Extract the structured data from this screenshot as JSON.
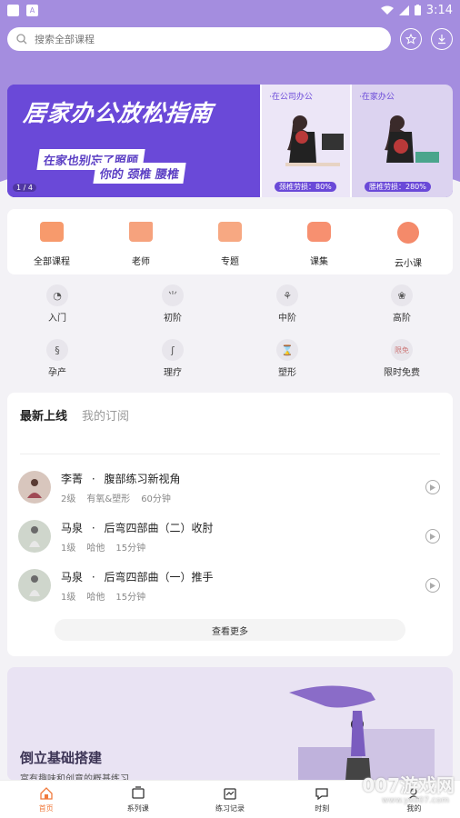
{
  "status_bar": {
    "time": "3:14"
  },
  "search": {
    "placeholder": "搜索全部课程"
  },
  "banner": {
    "title": "居家办公放松指南",
    "tag1": "在家也别忘了照顾",
    "tag2_prefix": "你的",
    "tag2_a": "颈椎",
    "tag2_b": "腰椎",
    "page": "1 / 4",
    "panel1_label": "·在公司办公",
    "panel1_pct": "颈椎劳损：80%",
    "panel2_label": "·在家办公",
    "panel2_pct": "腰椎劳损：280%"
  },
  "categories": [
    {
      "label": "全部课程",
      "icon": "all-courses-icon"
    },
    {
      "label": "老师",
      "icon": "teacher-icon"
    },
    {
      "label": "专题",
      "icon": "topic-icon"
    },
    {
      "label": "课集",
      "icon": "collection-icon"
    },
    {
      "label": "云小课",
      "icon": "cloud-class-icon"
    }
  ],
  "levels": [
    {
      "label": "入门",
      "icon": "beginner-icon"
    },
    {
      "label": "初阶",
      "icon": "elementary-icon"
    },
    {
      "label": "中阶",
      "icon": "intermediate-icon"
    },
    {
      "label": "高阶",
      "icon": "advanced-icon"
    },
    {
      "label": "孕产",
      "icon": "pregnancy-icon"
    },
    {
      "label": "理疗",
      "icon": "therapy-icon"
    },
    {
      "label": "塑形",
      "icon": "shaping-icon"
    },
    {
      "label": "限时免费",
      "icon": "free-icon",
      "badge": "限免"
    }
  ],
  "tabs": [
    {
      "label": "最新上线"
    },
    {
      "label": "我的订阅"
    }
  ],
  "courses": [
    {
      "teacher": "李菁",
      "sep": "·",
      "title": "腹部练习新视角",
      "level": "2级",
      "type": "有氧&塑形",
      "duration": "60分钟"
    },
    {
      "teacher": "马泉",
      "sep": "·",
      "title": "后弯四部曲（二）收肘",
      "level": "1级",
      "type": "哈他",
      "duration": "15分钟"
    },
    {
      "teacher": "马泉",
      "sep": "·",
      "title": "后弯四部曲（一）推手",
      "level": "1级",
      "type": "哈他",
      "duration": "15分钟"
    }
  ],
  "more_label": "查看更多",
  "promo": {
    "title": "倒立基础搭建",
    "subtitle": "富有趣味和创意的概基练习"
  },
  "bottom_nav": [
    {
      "label": "首页",
      "icon": "home-icon"
    },
    {
      "label": "系列课",
      "icon": "series-icon"
    },
    {
      "label": "练习记录",
      "icon": "record-icon"
    },
    {
      "label": "时刻",
      "icon": "moments-icon"
    },
    {
      "label": "我的",
      "icon": "profile-icon"
    }
  ],
  "watermark": {
    "main": "007游戏网",
    "sub": "www.yx007.com"
  },
  "colors": {
    "header": "#a48ddf",
    "banner": "#6a49d8",
    "accent": "#f07a3c"
  }
}
